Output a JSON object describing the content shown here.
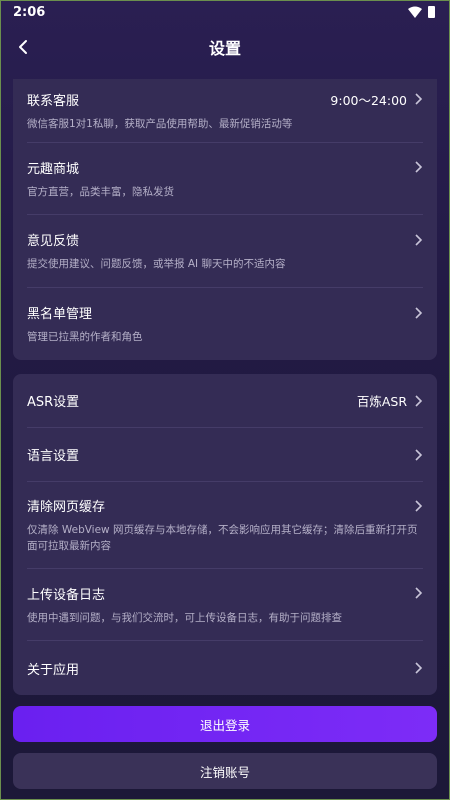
{
  "status_bar": {
    "time": "2:06"
  },
  "header": {
    "title": "设置"
  },
  "group1": [
    {
      "label": "联系客服",
      "value": "9:00～24:00",
      "sub": "微信客服1对1私聊，获取产品使用帮助、最新促销活动等"
    },
    {
      "label": "元趣商城",
      "value": "",
      "sub": "官方直营，品类丰富，隐私发货"
    },
    {
      "label": "意见反馈",
      "value": "",
      "sub": "提交使用建议、问题反馈，或举报 AI 聊天中的不适内容"
    },
    {
      "label": "黑名单管理",
      "value": "",
      "sub": "管理已拉黑的作者和角色"
    }
  ],
  "group2": [
    {
      "label": "ASR设置",
      "value": "百炼ASR",
      "sub": ""
    },
    {
      "label": "语言设置",
      "value": "",
      "sub": ""
    },
    {
      "label": "清除网页缓存",
      "value": "",
      "sub": "仅清除 WebView 网页缓存与本地存储，不会影响应用其它缓存；清除后重新打开页面可拉取最新内容"
    },
    {
      "label": "上传设备日志",
      "value": "",
      "sub": "使用中遇到问题，与我们交流时，可上传设备日志，有助于问题排查"
    },
    {
      "label": "关于应用",
      "value": "",
      "sub": ""
    }
  ],
  "actions": {
    "logout": "退出登录",
    "delete_account": "注销账号"
  }
}
